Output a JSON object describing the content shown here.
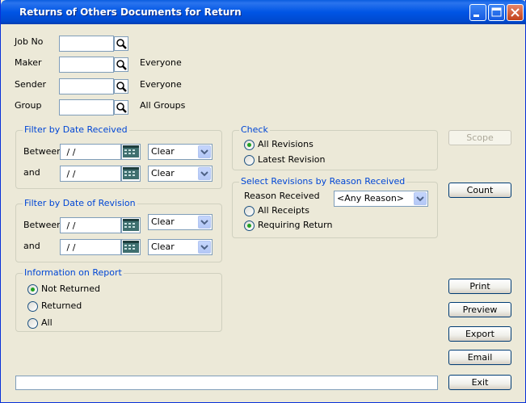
{
  "window": {
    "title": "Returns of Others Documents for Return"
  },
  "criteria": {
    "job_no": {
      "label": "Job No",
      "value": ""
    },
    "maker": {
      "label": "Maker",
      "value": "",
      "display": "Everyone"
    },
    "sender": {
      "label": "Sender",
      "value": "",
      "display": "Everyone"
    },
    "group": {
      "label": "Group",
      "value": "",
      "display": "All Groups"
    }
  },
  "date_received": {
    "title": "Filter by Date Received",
    "between_label": "Between",
    "and_label": "and",
    "from_value": " / /",
    "to_value": " / /",
    "from_option": "Clear",
    "to_option": "Clear"
  },
  "date_revision": {
    "title": "Filter by Date of Revision",
    "between_label": "Between",
    "and_label": "and",
    "from_value": " / /",
    "to_value": " / /",
    "from_option": "Clear",
    "to_option": "Clear"
  },
  "info_on_report": {
    "title": "Information on Report",
    "options": [
      "Not Returned",
      "Returned",
      "All"
    ],
    "selected": "Not Returned"
  },
  "check": {
    "title": "Check",
    "options": [
      "All Revisions",
      "Latest Revision"
    ],
    "selected": "All Revisions"
  },
  "reason": {
    "title": "Select Revisions by Reason Received",
    "label": "Reason Received",
    "value": "<Any Reason>",
    "options": [
      "All Receipts",
      "Requiring Return"
    ],
    "selected": "Requiring Return"
  },
  "buttons": {
    "scope": "Scope",
    "count": "Count",
    "print": "Print",
    "preview": "Preview",
    "export": "Export",
    "email": "Email",
    "exit": "Exit"
  },
  "colors": {
    "title_bar": "#0055e5",
    "group_title": "#0046d5",
    "radio_selected": "#21a121"
  }
}
